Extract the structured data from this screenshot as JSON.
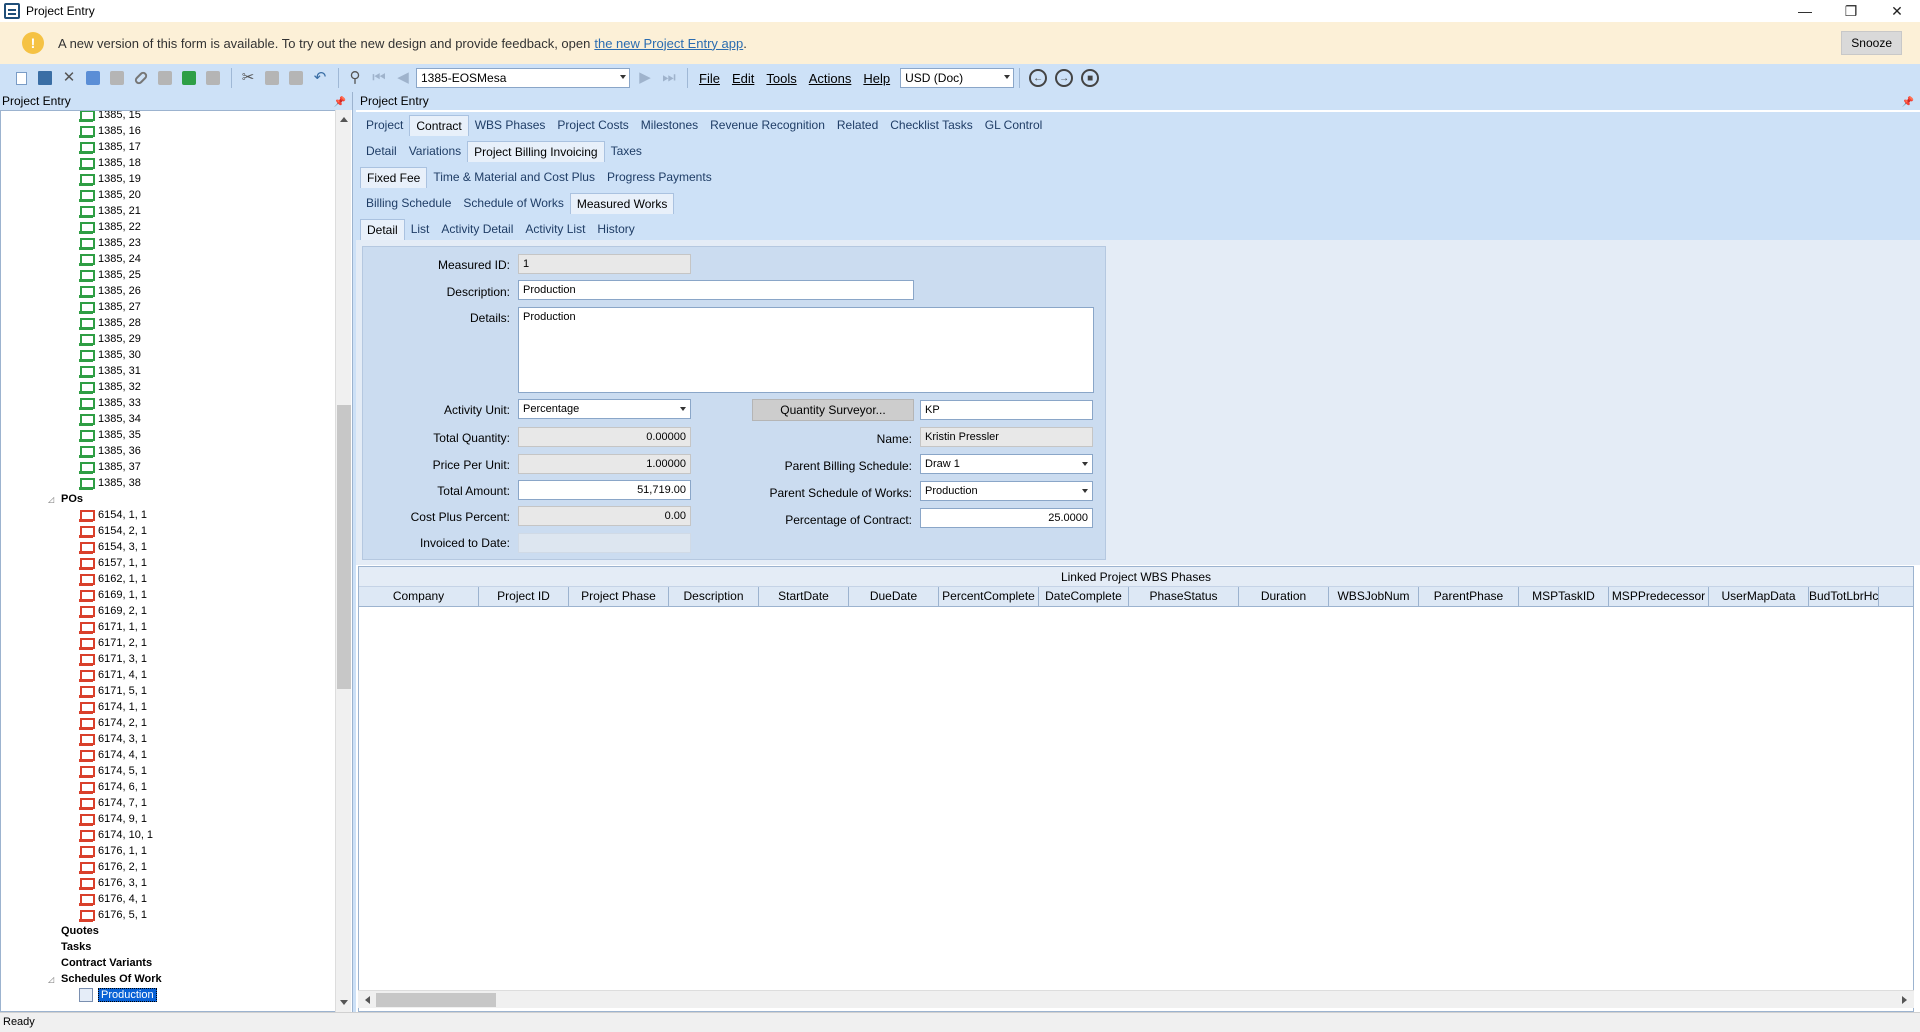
{
  "window": {
    "title": "Project Entry",
    "controls": [
      "—",
      "❐",
      "✕"
    ]
  },
  "banner": {
    "icon": "!",
    "text": "A new version of this form is available. To try out the new design and provide feedback, open",
    "link": "the new Project Entry app",
    "link_suffix": ".",
    "snooze_label": "Snooze"
  },
  "toolbar": {
    "project_combo": "1385-EOSMesa",
    "currency_combo": "USD (Doc)",
    "menus": [
      "File",
      "Edit",
      "Tools",
      "Actions",
      "Help"
    ]
  },
  "left_panel": {
    "title": "Project Entry",
    "tree_items_green": [
      "1385, 15",
      "1385, 16",
      "1385, 17",
      "1385, 18",
      "1385, 19",
      "1385, 20",
      "1385, 21",
      "1385, 22",
      "1385, 23",
      "1385, 24",
      "1385, 25",
      "1385, 26",
      "1385, 27",
      "1385, 28",
      "1385, 29",
      "1385, 30",
      "1385, 31",
      "1385, 32",
      "1385, 33",
      "1385, 34",
      "1385, 35",
      "1385, 36",
      "1385, 37",
      "1385, 38"
    ],
    "pos_label": "POs",
    "tree_items_red": [
      "6154, 1, 1",
      "6154, 2, 1",
      "6154, 3, 1",
      "6157, 1, 1",
      "6162, 1, 1",
      "6169, 1, 1",
      "6169, 2, 1",
      "6171, 1, 1",
      "6171, 2, 1",
      "6171, 3, 1",
      "6171, 4, 1",
      "6171, 5, 1",
      "6174, 1, 1",
      "6174, 2, 1",
      "6174, 3, 1",
      "6174, 4, 1",
      "6174, 5, 1",
      "6174, 6, 1",
      "6174, 7, 1",
      "6174, 9, 1",
      "6174, 10, 1",
      "6176, 1, 1",
      "6176, 2, 1",
      "6176, 3, 1",
      "6176, 4, 1",
      "6176, 5, 1"
    ],
    "quotes": "Quotes",
    "tasks": "Tasks",
    "contract_variants": "Contract Variants",
    "schedules": "Schedules Of Work",
    "selected_item": "Production"
  },
  "right_panel": {
    "title": "Project Entry",
    "tabs_l1": [
      "Project",
      "Contract",
      "WBS Phases",
      "Project Costs",
      "Milestones",
      "Revenue Recognition",
      "Related",
      "Checklist Tasks",
      "GL Control"
    ],
    "tabs_l2": [
      "Detail",
      "Variations",
      "Project Billing Invoicing",
      "Taxes"
    ],
    "tabs_l3": [
      "Fixed Fee",
      "Time & Material and Cost Plus",
      "Progress Payments"
    ],
    "tabs_l4": [
      "Billing Schedule",
      "Schedule of Works",
      "Measured Works"
    ],
    "tabs_l5": [
      "Detail",
      "List",
      "Activity Detail",
      "Activity List",
      "History"
    ]
  },
  "form": {
    "measured_id_label": "Measured ID:",
    "measured_id": "1",
    "description_label": "Description:",
    "description": "Production",
    "details_label": "Details:",
    "details": "Production",
    "activity_unit_label": "Activity Unit:",
    "activity_unit": "Percentage",
    "total_quantity_label": "Total Quantity:",
    "total_quantity": "0.00000",
    "price_per_unit_label": "Price Per Unit:",
    "price_per_unit": "1.00000",
    "total_amount_label": "Total Amount:",
    "total_amount": "51,719.00",
    "cost_plus_label": "Cost Plus Percent:",
    "cost_plus": "0.00",
    "invoiced_label": "Invoiced to Date:",
    "invoiced": "",
    "qs_button": "Quantity Surveyor...",
    "qs_value": "KP",
    "name_label": "Name:",
    "name": "Kristin Pressler",
    "parent_billing_label": "Parent Billing Schedule:",
    "parent_billing": "Draw 1",
    "parent_sow_label": "Parent Schedule of Works:",
    "parent_sow": "Production",
    "pct_contract_label": "Percentage of Contract:",
    "pct_contract": "25.0000"
  },
  "grid": {
    "caption": "Linked Project WBS Phases",
    "columns": [
      "Company",
      "Project ID",
      "Project Phase",
      "Description",
      "StartDate",
      "DueDate",
      "PercentComplete",
      "DateComplete",
      "PhaseStatus",
      "Duration",
      "WBSJobNum",
      "ParentPhase",
      "MSPTaskID",
      "MSPPredecessor",
      "UserMapData",
      "BudTotLbrHc"
    ]
  },
  "status": {
    "text": "Ready"
  }
}
